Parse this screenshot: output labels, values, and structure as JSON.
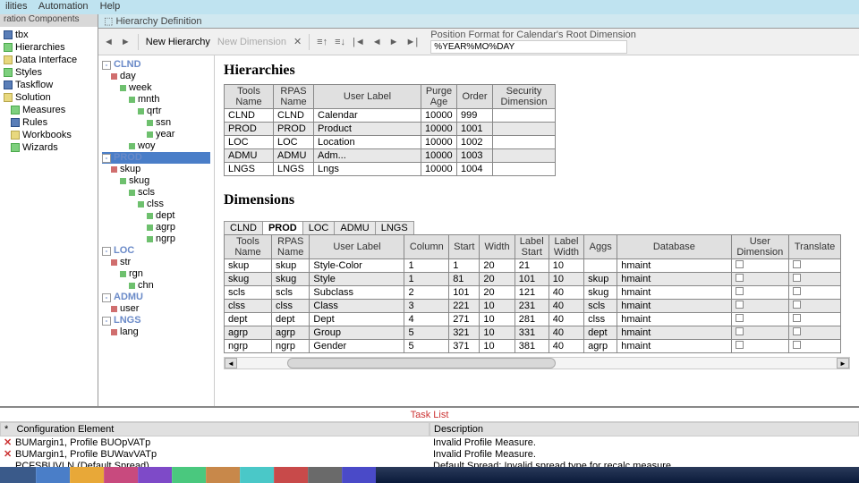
{
  "menu": {
    "items": [
      "ilities",
      "Automation",
      "Help"
    ]
  },
  "leftPanel": {
    "title": "ration Components",
    "items": [
      {
        "label": "tbx",
        "ico": "b"
      },
      {
        "label": "Hierarchies",
        "ico": "g"
      },
      {
        "label": "Data Interface",
        "ico": "y"
      },
      {
        "label": "Styles",
        "ico": "g"
      },
      {
        "label": "Taskflow",
        "ico": "b"
      },
      {
        "label": "Solution",
        "ico": "y"
      },
      {
        "label": "Measures",
        "ico": "g",
        "indent": 1
      },
      {
        "label": "Rules",
        "ico": "b",
        "indent": 1
      },
      {
        "label": "Workbooks",
        "ico": "y",
        "indent": 1
      },
      {
        "label": "Wizards",
        "ico": "g",
        "indent": 1
      }
    ]
  },
  "tabTitle": "Hierarchy Definition",
  "toolbar": {
    "newHier": "New Hierarchy",
    "newDim": "New Dimension",
    "posfmtLabel": "Position Format for Calendar's Root Dimension",
    "posfmtValue": "%YEAR%MO%DAY"
  },
  "hierTree": [
    {
      "label": "CLND",
      "lvl": 0,
      "sq": "hdr"
    },
    {
      "label": "day",
      "lvl": 1,
      "sq": "red"
    },
    {
      "label": "week",
      "lvl": 2,
      "sq": "green"
    },
    {
      "label": "mnth",
      "lvl": 3,
      "sq": "green"
    },
    {
      "label": "qrtr",
      "lvl": 4,
      "sq": "green"
    },
    {
      "label": "ssn",
      "lvl": 5,
      "sq": "green"
    },
    {
      "label": "year",
      "lvl": 5,
      "sq": "green"
    },
    {
      "label": "woy",
      "lvl": 3,
      "sq": "green"
    },
    {
      "label": "PROD",
      "lvl": 0,
      "sq": "hdr",
      "selected": true
    },
    {
      "label": "skup",
      "lvl": 1,
      "sq": "red"
    },
    {
      "label": "skug",
      "lvl": 2,
      "sq": "green"
    },
    {
      "label": "scls",
      "lvl": 3,
      "sq": "green"
    },
    {
      "label": "clss",
      "lvl": 4,
      "sq": "green"
    },
    {
      "label": "dept",
      "lvl": 5,
      "sq": "green"
    },
    {
      "label": "agrp",
      "lvl": 5,
      "sq": "green"
    },
    {
      "label": "ngrp",
      "lvl": 5,
      "sq": "green"
    },
    {
      "label": "LOC",
      "lvl": 0,
      "sq": "hdr"
    },
    {
      "label": "str",
      "lvl": 1,
      "sq": "red"
    },
    {
      "label": "rgn",
      "lvl": 2,
      "sq": "green"
    },
    {
      "label": "chn",
      "lvl": 3,
      "sq": "green"
    },
    {
      "label": "ADMU",
      "lvl": 0,
      "sq": "hdr"
    },
    {
      "label": "user",
      "lvl": 1,
      "sq": "red"
    },
    {
      "label": "LNGS",
      "lvl": 0,
      "sq": "hdr"
    },
    {
      "label": "lang",
      "lvl": 1,
      "sq": "red"
    }
  ],
  "hierarchies": {
    "title": "Hierarchies",
    "headers": [
      "Tools Name",
      "RPAS Name",
      "User Label",
      "Purge Age",
      "Order",
      "Security Dimension"
    ],
    "rows": [
      [
        "CLND",
        "CLND",
        "Calendar",
        "10000",
        "999",
        ""
      ],
      [
        "PROD",
        "PROD",
        "Product",
        "10000",
        "1001",
        ""
      ],
      [
        "LOC",
        "LOC",
        "Location",
        "10000",
        "1002",
        ""
      ],
      [
        "ADMU",
        "ADMU",
        "Adm...",
        "10000",
        "1003",
        ""
      ],
      [
        "LNGS",
        "LNGS",
        "Lngs",
        "10000",
        "1004",
        ""
      ]
    ]
  },
  "dimensions": {
    "title": "Dimensions",
    "tabs": [
      "CLND",
      "PROD",
      "LOC",
      "ADMU",
      "LNGS"
    ],
    "activeTab": 1,
    "headers": [
      "Tools Name",
      "RPAS Name",
      "User Label",
      "Column",
      "Start",
      "Width",
      "Label Start",
      "Label Width",
      "Aggs",
      "Database",
      "User Dimension",
      "Translate"
    ],
    "rows": [
      [
        "skup",
        "skup",
        "Style-Color",
        "1",
        "1",
        "20",
        "21",
        "10",
        "",
        "hmaint",
        "cb",
        "cb"
      ],
      [
        "skug",
        "skug",
        "Style",
        "1",
        "81",
        "20",
        "101",
        "10",
        "skup",
        "hmaint",
        "cb",
        "cb"
      ],
      [
        "scls",
        "scls",
        "Subclass",
        "2",
        "101",
        "20",
        "121",
        "40",
        "skug",
        "hmaint",
        "cb",
        "cb"
      ],
      [
        "clss",
        "clss",
        "Class",
        "3",
        "221",
        "10",
        "231",
        "40",
        "scls",
        "hmaint",
        "cb",
        "cb"
      ],
      [
        "dept",
        "dept",
        "Dept",
        "4",
        "271",
        "10",
        "281",
        "40",
        "clss",
        "hmaint",
        "cb",
        "cb"
      ],
      [
        "agrp",
        "agrp",
        "Group",
        "5",
        "321",
        "10",
        "331",
        "40",
        "dept",
        "hmaint",
        "cb",
        "cb"
      ],
      [
        "ngrp",
        "ngrp",
        "Gender",
        "5",
        "371",
        "10",
        "381",
        "40",
        "agrp",
        "hmaint",
        "cb",
        "cb"
      ]
    ]
  },
  "taskList": {
    "title": "Task List",
    "headers": [
      "Configuration Element",
      "Description"
    ],
    "rows": [
      {
        "x": true,
        "c": "BUMargin1, Profile   BUOpVATp",
        "d": "Invalid Profile Measure."
      },
      {
        "x": true,
        "c": "BUMargin1, Profile   BUWavVATp",
        "d": "Invalid Profile Measure."
      },
      {
        "x": false,
        "c": "PCFSBUVLN (Default Spread)",
        "d": "Default Spread: Invalid spread type for recalc measure."
      }
    ]
  }
}
